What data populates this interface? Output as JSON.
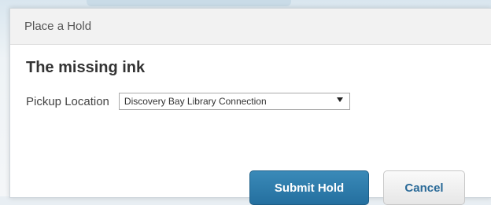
{
  "dialog": {
    "title": "Place a Hold",
    "item_title": "The missing ink",
    "pickup": {
      "label": "Pickup Location",
      "selected": "Discovery Bay Library Connection"
    },
    "buttons": {
      "submit": "Submit Hold",
      "cancel": "Cancel"
    }
  },
  "colors": {
    "submit_bg": "#2f7fb0",
    "cancel_text": "#2a6a98",
    "header_bg": "#f2f2f2"
  }
}
